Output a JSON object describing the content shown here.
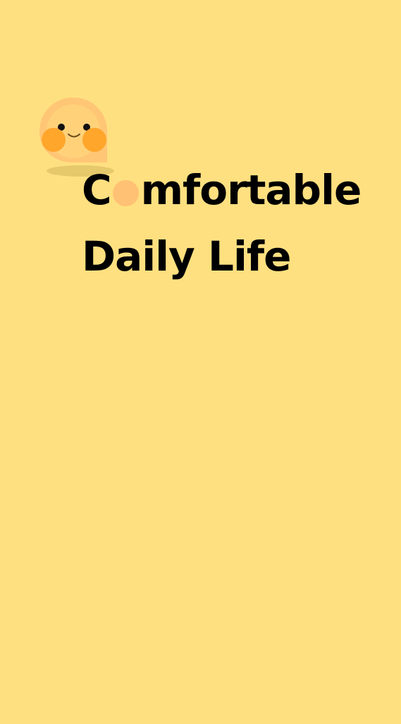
{
  "colors": {
    "background": "#FFE080",
    "text": "#000000",
    "mascot_face": "#FFC174",
    "mascot_cheeks": "#FFA62B"
  },
  "mascot": {
    "icon": "smiling-chat-bubble-icon"
  },
  "tagline": {
    "line1_start": "C",
    "line1_end": "mfortable",
    "line2": "Daily Life"
  }
}
